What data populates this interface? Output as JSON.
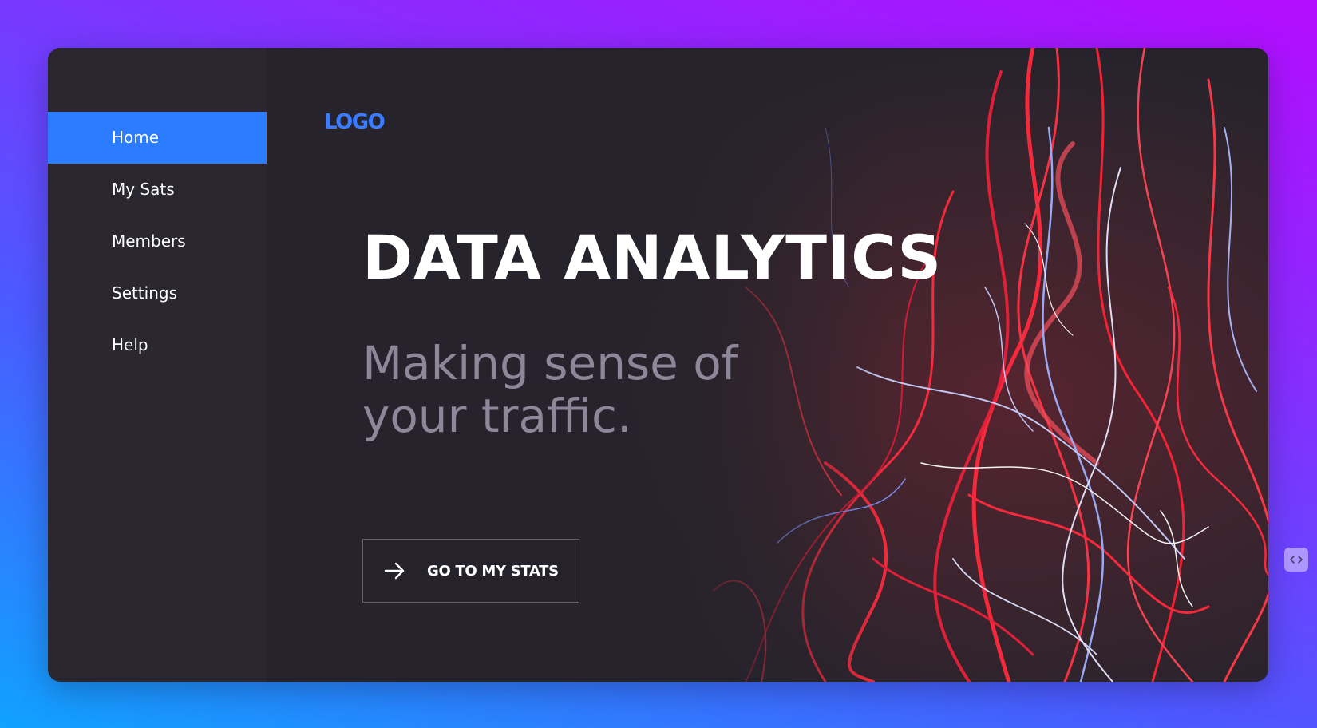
{
  "sidebar": {
    "items": [
      {
        "label": "Home",
        "active": true
      },
      {
        "label": "My Sats",
        "active": false
      },
      {
        "label": "Members",
        "active": false
      },
      {
        "label": "Settings",
        "active": false
      },
      {
        "label": "Help",
        "active": false
      }
    ]
  },
  "header": {
    "logo": "LOGO"
  },
  "hero": {
    "title": "DATA ANALYTICS",
    "subtitle_line1": "Making sense of",
    "subtitle_line2": "your traffic.",
    "cta_label": "GO TO MY STATS",
    "cta_icon": "arrow-right-icon",
    "background_image": "red and blue light trails"
  },
  "corner_widget": {
    "icon": "code-icon"
  },
  "colors": {
    "accent": "#2c7cff",
    "logo": "#3a7bff",
    "card_bg": "#26232c",
    "sidebar_bg": "#2a2730",
    "subtitle": "#8e8799",
    "gradient_top_right": "#b40cff",
    "gradient_bottom_left": "#10a2ff"
  }
}
